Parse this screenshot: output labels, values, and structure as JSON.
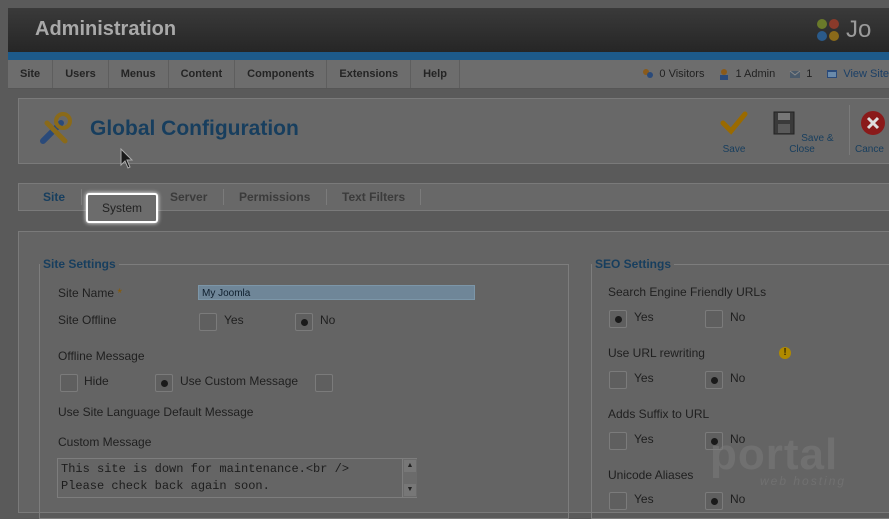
{
  "header": {
    "title": "Administration",
    "brand_text": "Jo"
  },
  "menu": {
    "items": [
      "Site",
      "Users",
      "Menus",
      "Content",
      "Components",
      "Extensions",
      "Help"
    ]
  },
  "status": {
    "visitors": "0 Visitors",
    "admins": "1 Admin",
    "messages": "1",
    "view_site": "View Site"
  },
  "toolbar": {
    "title": "Global Configuration",
    "save": "Save",
    "save_close": "Save & Close",
    "cancel": "Cance"
  },
  "tabs": [
    "Site",
    "System",
    "Server",
    "Permissions",
    "Text Filters"
  ],
  "site_settings": {
    "legend": "Site Settings",
    "site_name_label": "Site Name",
    "required_mark": "*",
    "site_name_value": "My Joomla",
    "site_offline_label": "Site Offline",
    "yes": "Yes",
    "no": "No",
    "offline_message_label": "Offline Message",
    "hide": "Hide",
    "use_custom": "Use Custom Message",
    "use_lang_default": "Use Site Language Default Message",
    "custom_message_label": "Custom Message",
    "custom_message_line1": "This site is down for maintenance.<br />",
    "custom_message_line2": "Please check back again soon."
  },
  "seo_settings": {
    "legend": "SEO Settings",
    "sef_label": "Search Engine Friendly URLs",
    "rewrite_label": "Use URL rewriting",
    "suffix_label": "Adds Suffix to URL",
    "unicode_label": "Unicode Aliases",
    "yes": "Yes",
    "no": "No"
  },
  "colors": {
    "accent": "#1d5a8a",
    "title": "#173e5e"
  },
  "watermark": {
    "text": "portal",
    "sub": "web hosting"
  }
}
